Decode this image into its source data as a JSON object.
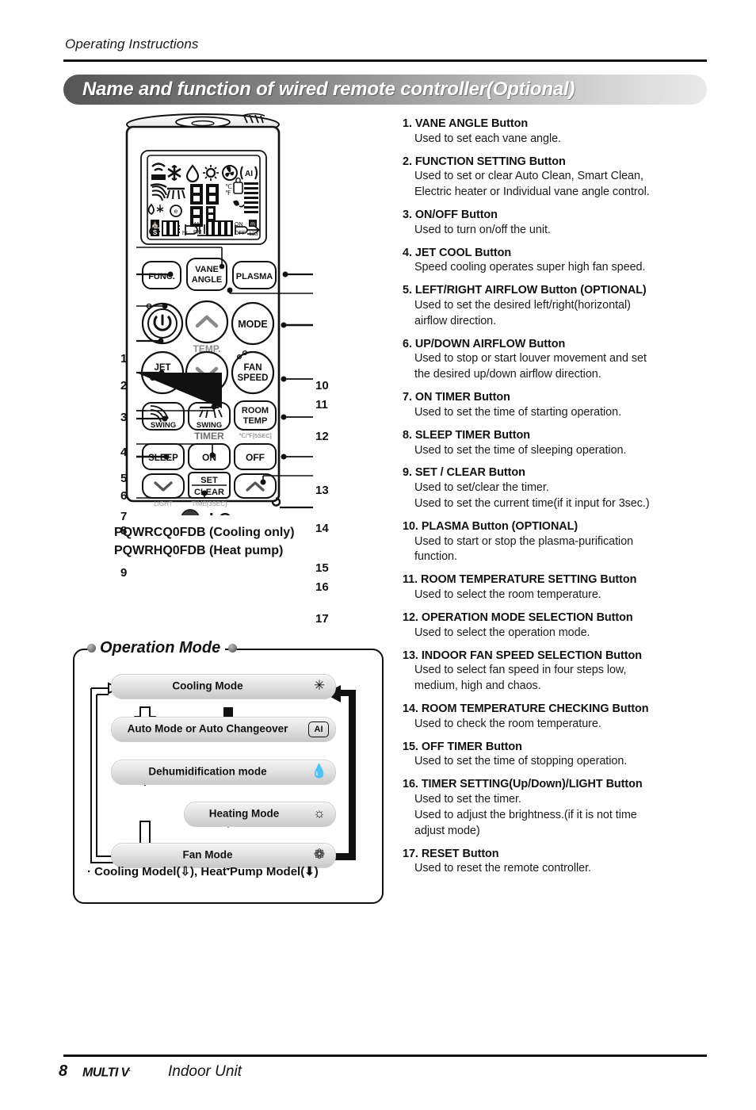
{
  "header": {
    "kicker": "Operating Instructions",
    "title": "Name and function of wired remote controller(Optional)"
  },
  "remote": {
    "lcd": {
      "row1_icons": [
        "signal-bars-icon",
        "snowflake-icon",
        "water-drop-icon",
        "sun-icon",
        "fan-icon",
        "ai-icon"
      ],
      "row2_icons": [
        "up-down-swing-icon",
        "left-right-swing-icon",
        "two-digit-temp",
        "celsius-fahrenheit",
        "lock-icon",
        "filter-bars"
      ],
      "row3_icons": [
        "plasma-icon",
        "card-icon",
        "vane-icon",
        "louver-icon",
        "clean-icon",
        "airflow-icon",
        "arrow-icon"
      ],
      "bottom": {
        "set_icon": "building-icon",
        "sleep_icon": "S",
        "hours": "0.0",
        "hours_unit": "hr.",
        "am": "AM",
        "pm": "PM",
        "clock": "0:00",
        "on_label": "ON",
        "off_label": "OFF",
        "zone_icon": "m",
        "zones": "123"
      }
    },
    "buttons": [
      {
        "id": "func",
        "label": "FUNC.",
        "shape": "rounded-rect"
      },
      {
        "id": "vane-angle",
        "label": "VANE\nANGLE",
        "shape": "rounded-rect"
      },
      {
        "id": "plasma",
        "label": "PLASMA",
        "shape": "rounded-rect"
      },
      {
        "id": "power",
        "label": "power-icon",
        "shape": "circle"
      },
      {
        "id": "temp-up",
        "label": "chevron-up-icon",
        "shape": "circle"
      },
      {
        "id": "mode",
        "label": "MODE",
        "shape": "circle"
      },
      {
        "id": "jet-cool",
        "label": "JET\nCOOL",
        "shape": "circle"
      },
      {
        "id": "temp-down",
        "label": "chevron-down-icon",
        "shape": "circle"
      },
      {
        "id": "fan-speed",
        "label": "FAN\nSPEED",
        "shape": "circle"
      },
      {
        "id": "swing-ud",
        "label": "SWING",
        "shape": "rounded-rect"
      },
      {
        "id": "swing-lr",
        "label": "SWING",
        "shape": "rounded-rect"
      },
      {
        "id": "room-temp",
        "label": "ROOM\nTEMP",
        "shape": "rounded-rect"
      },
      {
        "id": "sleep",
        "label": "SLEEP",
        "shape": "rounded-rect"
      },
      {
        "id": "timer-on",
        "label": "ON",
        "shape": "rounded-rect"
      },
      {
        "id": "timer-off",
        "label": "OFF",
        "shape": "rounded-rect"
      },
      {
        "id": "timer-down",
        "label": "chevron-down-icon",
        "shape": "rounded-rect"
      },
      {
        "id": "set-clear",
        "label": "SET / CLEAR",
        "shape": "rounded-rect"
      },
      {
        "id": "timer-up",
        "label": "chevron-up-icon",
        "shape": "rounded-rect"
      }
    ],
    "captions": {
      "temp": "TEMP.",
      "timer": "TIMER",
      "room_temp_sub": "℃/℉[5SEC]",
      "light": "LIGHT",
      "time_sub": "TIME[3SEC]"
    },
    "brand": "LG",
    "callouts_left": [
      "1",
      "2",
      "3",
      "4",
      "5",
      "6",
      "7",
      "8",
      "9"
    ],
    "callouts_right": [
      "10",
      "11",
      "12",
      "13",
      "14",
      "15",
      "16",
      "17"
    ],
    "model_lines": [
      "PQWRCQ0FDB (Cooling only)",
      "PQWRHQ0FDB (Heat pump)"
    ]
  },
  "operation_mode": {
    "title": "Operation Mode",
    "modes": [
      {
        "label": "Cooling Mode",
        "icon": "snowflake-icon",
        "glyph": "✳"
      },
      {
        "label": "Auto Mode or Auto Changeover",
        "icon": "ai-icon",
        "glyph": "AI"
      },
      {
        "label": "Dehumidification mode",
        "icon": "water-drop-icon",
        "glyph": "◇"
      },
      {
        "label": "Heating Mode",
        "icon": "sun-icon",
        "glyph": "☀"
      },
      {
        "label": "Fan Mode",
        "icon": "fan-icon",
        "glyph": "❁"
      }
    ],
    "legend": "· Cooling Model(⇩), Heat Pump Model(⬇)"
  },
  "functions": [
    {
      "num": "1.",
      "title": "VANE ANGLE Button",
      "desc": [
        "Used to set each vane angle."
      ]
    },
    {
      "num": "2.",
      "title": "FUNCTION SETTING Button",
      "desc": [
        "Used to set or clear Auto Clean, Smart Clean,",
        "Electric heater or Individual vane angle control."
      ]
    },
    {
      "num": "3.",
      "title": " ON/OFF Button",
      "desc": [
        " Used to turn on/off the unit."
      ]
    },
    {
      "num": "4.",
      "title": "JET COOL Button",
      "desc": [
        "Speed cooling operates super high fan speed."
      ]
    },
    {
      "num": "5.",
      "title": "LEFT/RIGHT AIRFLOW Button (OPTIONAL)",
      "desc": [
        "Used to set the desired left/right(horizontal)",
        "airflow direction."
      ]
    },
    {
      "num": "6.",
      "title": "UP/DOWN AIRFLOW Button",
      "desc": [
        "Used to stop or start louver movement and set",
        "the desired up/down airflow direction."
      ]
    },
    {
      "num": "7.",
      "title": "ON TIMER Button",
      "desc": [
        "Used to set the time of starting operation."
      ]
    },
    {
      "num": "8.",
      "title": "SLEEP TIMER Button",
      "desc": [
        "Used to set the time of sleeping operation."
      ]
    },
    {
      "num": "9.",
      "title": "SET / CLEAR Button",
      "desc": [
        "Used to set/clear the timer.",
        "Used to set the current time(if it input for 3sec.)"
      ]
    },
    {
      "num": "10.",
      "title": "PLASMA Button (OPTIONAL)",
      "desc": [
        " Used to start or stop the plasma-purification",
        "function."
      ]
    },
    {
      "num": "11.",
      "title": "ROOM TEMPERATURE SETTING Button",
      "desc": [
        "Used to select the room temperature."
      ]
    },
    {
      "num": "12.",
      "title": "OPERATION MODE SELECTION Button",
      "desc": [
        "Used to select the operation mode."
      ]
    },
    {
      "num": "13.",
      "title": "INDOOR FAN SPEED SELECTION Button",
      "desc": [
        "Used to select fan speed in four steps low,",
        "medium, high and chaos."
      ]
    },
    {
      "num": "14.",
      "title": "ROOM TEMPERATURE CHECKING Button",
      "desc": [
        "Used to check the room temperature."
      ]
    },
    {
      "num": "15.",
      "title": "OFF TIMER Button",
      "desc": [
        "Used to set the time of stopping operation."
      ]
    },
    {
      "num": "16.",
      "title": "TIMER SETTING(Up/Down)/LIGHT Button",
      "desc": [
        "Used to set the timer.",
        "Used to adjust the brightness.(if it is not time",
        "adjust mode)"
      ]
    },
    {
      "num": "17.",
      "title": "RESET Button",
      "desc": [
        "Used to reset the remote controller."
      ]
    }
  ],
  "footer": {
    "page": "8",
    "brand": "MULTI V",
    "brand_tm": ".",
    "text": "Indoor Unit"
  }
}
